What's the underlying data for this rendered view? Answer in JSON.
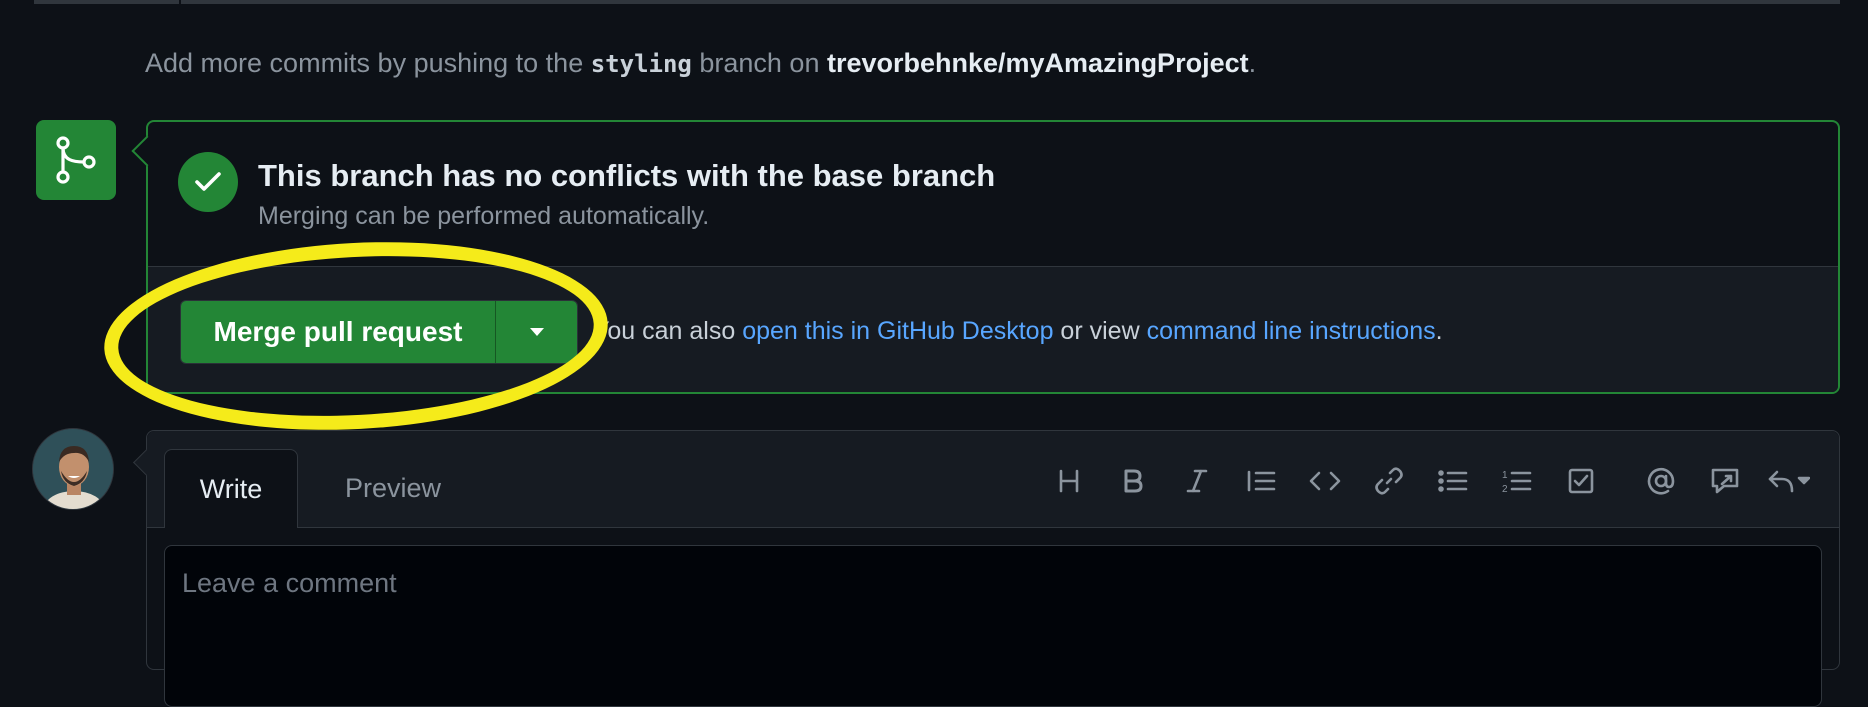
{
  "hint": {
    "prefix": "Add more commits by pushing to the ",
    "branch": "styling",
    "middle": " branch on ",
    "repo": "trevorbehnke/myAmazingProject",
    "suffix": "."
  },
  "merge_status": {
    "title": "This branch has no conflicts with the base branch",
    "subtitle": "Merging can be performed automatically."
  },
  "merge_actions": {
    "merge_button_label": "Merge pull request",
    "also_prefix": "You can also ",
    "desktop_link": "open this in GitHub Desktop",
    "also_middle": " or view ",
    "cli_link": "command line instructions",
    "also_suffix": "."
  },
  "comment": {
    "tabs": [
      "Write",
      "Preview"
    ],
    "active_tab": "Write",
    "placeholder": "Leave a comment",
    "toolbar_icons": [
      "heading-icon",
      "bold-icon",
      "italic-icon",
      "quote-icon",
      "code-icon",
      "link-icon",
      "bulleted-list-icon",
      "numbered-list-icon",
      "task-list-icon",
      "mention-icon",
      "reference-icon",
      "saved-replies-icon"
    ]
  },
  "colors": {
    "background": "#0d1117",
    "success_green": "#238636",
    "link_blue": "#58a6ff",
    "highlight_yellow": "#f5eb1a"
  }
}
